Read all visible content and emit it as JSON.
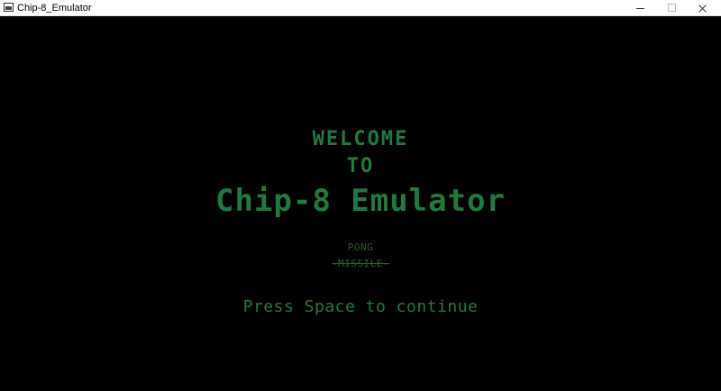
{
  "window": {
    "title": "Chip-8_Emulator"
  },
  "colors": {
    "background": "#000000",
    "text_green": "#1f7a3c",
    "titlebar": "#ffffff"
  },
  "screen": {
    "welcome": "WELCOME",
    "to": "TO",
    "headline": "Chip-8 Emulator",
    "menu": {
      "items": [
        "PONG",
        "-MISSILE-"
      ]
    },
    "prompt": "Press Space to continue"
  }
}
